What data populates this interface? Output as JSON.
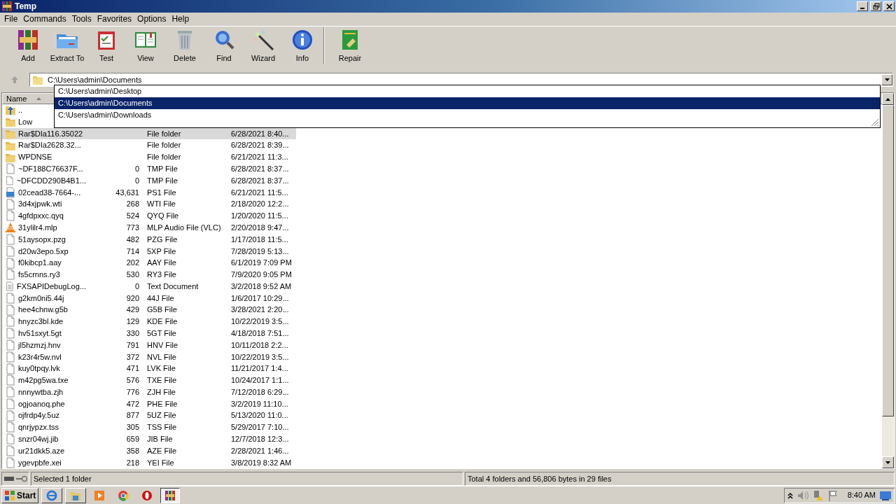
{
  "window": {
    "title": "Temp"
  },
  "menu": [
    "File",
    "Commands",
    "Tools",
    "Favorites",
    "Options",
    "Help"
  ],
  "toolbar": {
    "groups": [
      [
        {
          "label": "Add"
        },
        {
          "label": "Extract To"
        },
        {
          "label": "Test"
        },
        {
          "label": "View"
        },
        {
          "label": "Delete"
        },
        {
          "label": "Find"
        },
        {
          "label": "Wizard"
        },
        {
          "label": "Info"
        }
      ],
      [
        {
          "label": "Repair"
        }
      ]
    ]
  },
  "address": {
    "value": "C:\\Users\\admin\\Documents",
    "suggestions": [
      {
        "text": "C:\\Users\\admin\\Desktop",
        "selected": false
      },
      {
        "text": "C:\\Users\\admin\\Documents",
        "selected": true
      },
      {
        "text": "C:\\Users\\admin\\Downloads",
        "selected": false
      }
    ]
  },
  "file_list": {
    "columns": [
      {
        "label": "Name",
        "sorted": true
      }
    ],
    "rows": [
      {
        "kind": "up",
        "name": "..",
        "selected": false
      },
      {
        "kind": "folder",
        "name": "Low",
        "selected": false
      },
      {
        "kind": "folder",
        "name": "Rar$DIa116.35022",
        "type": "File folder",
        "modified": "6/28/2021 8:40...",
        "selected": true
      },
      {
        "kind": "folder",
        "name": "Rar$DIa2628.32...",
        "type": "File folder",
        "modified": "6/28/2021 8:39...",
        "selected": false
      },
      {
        "kind": "folder",
        "name": "WPDNSE",
        "type": "File folder",
        "modified": "6/21/2021 11:3...",
        "selected": false
      },
      {
        "kind": "file",
        "name": "~DF188C76637F...",
        "size": "0",
        "type": "TMP File",
        "modified": "6/28/2021 8:37...",
        "selected": false
      },
      {
        "kind": "file",
        "name": "~DFCDD290B4B1...",
        "size": "0",
        "type": "TMP File",
        "modified": "6/28/2021 8:37...",
        "selected": false
      },
      {
        "kind": "script",
        "name": "02cead38-7664-...",
        "size": "43,631",
        "type": "PS1 File",
        "modified": "6/21/2021 11:5...",
        "selected": false
      },
      {
        "kind": "file",
        "name": "3d4xjpwk.wti",
        "size": "268",
        "type": "WTI File",
        "modified": "2/18/2020 12:2...",
        "selected": false
      },
      {
        "kind": "file",
        "name": "4gfdpxxc.qyq",
        "size": "524",
        "type": "QYQ File",
        "modified": "1/20/2020 11:5...",
        "selected": false
      },
      {
        "kind": "media",
        "name": "31ylilr4.mlp",
        "size": "773",
        "type": "MLP Audio File (VLC)",
        "modified": "2/20/2018 9:47...",
        "selected": false
      },
      {
        "kind": "file",
        "name": "51aysopx.pzg",
        "size": "482",
        "type": "PZG File",
        "modified": "1/17/2018 11:5...",
        "selected": false
      },
      {
        "kind": "file",
        "name": "d20w3epo.5xp",
        "size": "714",
        "type": "5XP File",
        "modified": "7/28/2019 5:13...",
        "selected": false
      },
      {
        "kind": "file",
        "name": "f0kibcp1.aay",
        "size": "202",
        "type": "AAY File",
        "modified": "6/1/2019 7:09 PM",
        "selected": false
      },
      {
        "kind": "file",
        "name": "fs5crnns.ry3",
        "size": "530",
        "type": "RY3 File",
        "modified": "7/9/2020 9:05 PM",
        "selected": false
      },
      {
        "kind": "text",
        "name": "FXSAPIDebugLog...",
        "size": "0",
        "type": "Text Document",
        "modified": "3/2/2018 9:52 AM",
        "selected": false
      },
      {
        "kind": "file",
        "name": "g2km0ni5.44j",
        "size": "920",
        "type": "44J File",
        "modified": "1/6/2017 10:29...",
        "selected": false
      },
      {
        "kind": "file",
        "name": "hee4chnw.g5b",
        "size": "429",
        "type": "G5B File",
        "modified": "3/28/2021 2:20...",
        "selected": false
      },
      {
        "kind": "file",
        "name": "hnyzc3bl.kde",
        "size": "129",
        "type": "KDE File",
        "modified": "10/22/2019 3:5...",
        "selected": false
      },
      {
        "kind": "file",
        "name": "hv51sxyt.5gt",
        "size": "330",
        "type": "5GT File",
        "modified": "4/18/2018 7:51...",
        "selected": false
      },
      {
        "kind": "file",
        "name": "jl5hzmzj.hnv",
        "size": "791",
        "type": "HNV File",
        "modified": "10/11/2018 2:2...",
        "selected": false
      },
      {
        "kind": "file",
        "name": "k23r4r5w.nvl",
        "size": "372",
        "type": "NVL File",
        "modified": "10/22/2019 3:5...",
        "selected": false
      },
      {
        "kind": "file",
        "name": "kuy0tpqy.lvk",
        "size": "471",
        "type": "LVK File",
        "modified": "11/21/2017 1:4...",
        "selected": false
      },
      {
        "kind": "file",
        "name": "m42pg5wa.txe",
        "size": "576",
        "type": "TXE File",
        "modified": "10/24/2017 1:1...",
        "selected": false
      },
      {
        "kind": "file",
        "name": "nnnywtba.zjh",
        "size": "776",
        "type": "ZJH File",
        "modified": "7/12/2018 6:29...",
        "selected": false
      },
      {
        "kind": "file",
        "name": "ogjoanoq.phe",
        "size": "472",
        "type": "PHE File",
        "modified": "3/2/2019 11:10...",
        "selected": false
      },
      {
        "kind": "file",
        "name": "ojfrdp4y.5uz",
        "size": "877",
        "type": "5UZ File",
        "modified": "5/13/2020 11:0...",
        "selected": false
      },
      {
        "kind": "file",
        "name": "qnrjypzx.tss",
        "size": "305",
        "type": "TSS File",
        "modified": "5/29/2017 7:10...",
        "selected": false
      },
      {
        "kind": "file",
        "name": "snzr04wj.jib",
        "size": "659",
        "type": "JIB File",
        "modified": "12/7/2018 12:3...",
        "selected": false
      },
      {
        "kind": "file",
        "name": "ur21dkk5.aze",
        "size": "358",
        "type": "AZE File",
        "modified": "2/28/2021 1:46...",
        "selected": false
      },
      {
        "kind": "file",
        "name": "ygevpbfe.xei",
        "size": "218",
        "type": "YEI File",
        "modified": "3/8/2019 8:32 AM",
        "selected": false
      }
    ]
  },
  "status_bar": {
    "selection": "Selected 1 folder",
    "total": "Total 4 folders and 56,806 bytes in 29 files"
  },
  "taskbar": {
    "start": "Start",
    "clock": "8:40 AM"
  }
}
